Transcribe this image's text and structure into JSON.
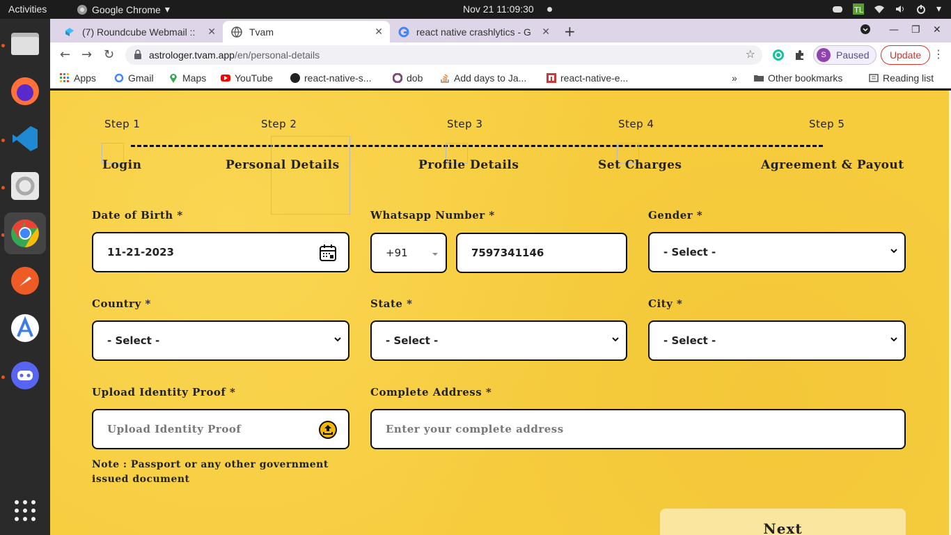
{
  "system": {
    "activities": "Activities",
    "app_name": "Google Chrome",
    "clock": "Nov 21  11:09:30"
  },
  "tabs": [
    {
      "title": "(7) Roundcube Webmail ::",
      "active": false
    },
    {
      "title": "Tvam",
      "active": true
    },
    {
      "title": "react native crashlytics - G",
      "active": false
    }
  ],
  "toolbar": {
    "url_host": "astrologer.tvam.app",
    "url_path": "/en/personal-details",
    "profile_initial": "S",
    "profile_status": "Paused",
    "update_label": "Update"
  },
  "bookmarks": [
    {
      "label": "Apps"
    },
    {
      "label": "Gmail"
    },
    {
      "label": "Maps"
    },
    {
      "label": "YouTube"
    },
    {
      "label": "react-native-s..."
    },
    {
      "label": "dob"
    },
    {
      "label": "Add days to Ja..."
    },
    {
      "label": "react-native-e..."
    }
  ],
  "bookmarks_more": "»",
  "bookmarks_other": "Other bookmarks",
  "bookmarks_reading": "Reading list",
  "steps": [
    {
      "num": "Step 1",
      "label": "Login"
    },
    {
      "num": "Step 2",
      "label": "Personal Details"
    },
    {
      "num": "Step 3",
      "label": "Profile Details"
    },
    {
      "num": "Step 4",
      "label": "Set Charges"
    },
    {
      "num": "Step 5",
      "label": "Agreement & Payout"
    }
  ],
  "form": {
    "dob_label": "Date of Birth *",
    "dob_value": "11-21-2023",
    "whatsapp_label": "Whatsapp Number *",
    "country_code": "+91",
    "whatsapp_value": "7597341146",
    "gender_label": "Gender *",
    "gender_value": "- Select -",
    "country_label": "Country *",
    "country_value": "- Select -",
    "state_label": "State *",
    "state_value": "- Select -",
    "city_label": "City *",
    "city_value": "- Select -",
    "id_label": "Upload Identity Proof *",
    "id_placeholder": "Upload Identity Proof",
    "address_label": "Complete Address *",
    "address_placeholder": "Enter your complete address",
    "note": "Note : Passport or any other government issued document",
    "next_label": "Next"
  },
  "colors": {
    "page_bg": "#f7cd3e",
    "tabbar_bg": "#ded6e8",
    "update_red": "#d93025"
  }
}
